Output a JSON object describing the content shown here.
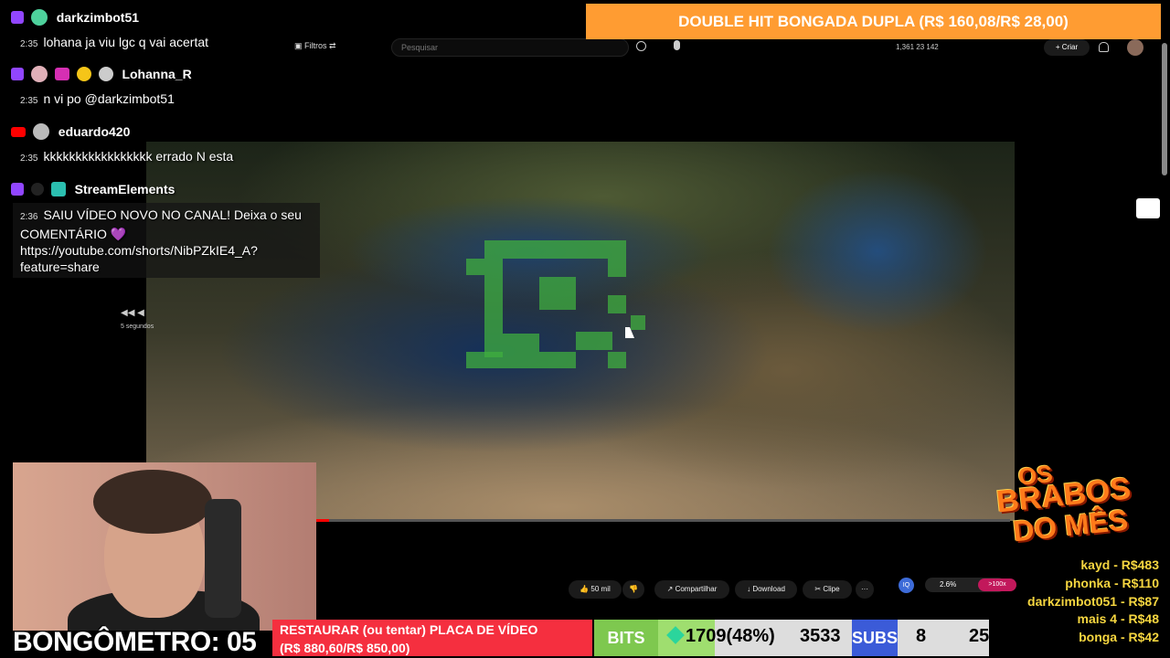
{
  "chat": [
    {
      "platform": "twitch",
      "user": "darkzimbot51",
      "time": "2:35",
      "message": "lohana ja viu lgc q vai acertat"
    },
    {
      "platform": "twitch",
      "user": "Lohanna_R",
      "time": "2:35",
      "message": "n vi po @darkzimbot51"
    },
    {
      "platform": "youtube",
      "user": "eduardo420",
      "time": "2:35",
      "message": "kkkkkkkkkkkkkkkkk errado N esta"
    },
    {
      "platform": "twitch",
      "user": "StreamElements",
      "time": "2:36",
      "message_line1": "SAIU VÍDEO NOVO NO CANAL! Deixa o seu",
      "message_line2": "COMENTÁRIO 💜",
      "message_line3": "https://youtube.com/shorts/NibPZkIE4_A?",
      "message_line4": "feature=share"
    }
  ],
  "donation_banner": "DOUBLE HIT BONGADA DUPLA (R$ 160,08/R$ 28,00)",
  "youtube": {
    "filters_label": "Filtros",
    "search_placeholder": "Pesquisar",
    "stats": "1,361  23  142",
    "create_label": "Criar",
    "rewind_label": "5 segundos",
    "like_label": "50 mil",
    "share_label": "Compartilhar",
    "download_label": "Download",
    "clip_label": "Clipe",
    "more_label": "···",
    "qi_label": "IQ",
    "percent_value": "2.6%",
    "percent_tag": ">100x"
  },
  "bongometro": "BONGÔMETRO: 05",
  "goal": {
    "line1": "RESTAURAR (ou tentar) PLACA DE VÍDEO",
    "line2": "(R$ 880,60/R$ 850,00)"
  },
  "bits": {
    "label": "BITS",
    "value": "1709(48%)",
    "goal": "3533"
  },
  "subs": {
    "label": "SUBS",
    "value": "8",
    "goal": "25"
  },
  "leaderboard": {
    "logo_line1": "OS",
    "logo_line2": "BRABOS",
    "logo_line3": "DO MÊS",
    "entries": [
      "kayd - R$483",
      "phonka - R$110",
      "darkzimbot051 - R$87",
      "mais 4 - R$48",
      "bonga - R$42"
    ]
  },
  "colors": {
    "twitch": "#9146ff",
    "youtube_red": "#ff0000",
    "banner_orange": "#ff9c32",
    "goal_red": "#f52f3f",
    "bits_green": "#7ec84f",
    "subs_blue": "#3b5bd8",
    "leader_yellow": "#f6d640"
  }
}
